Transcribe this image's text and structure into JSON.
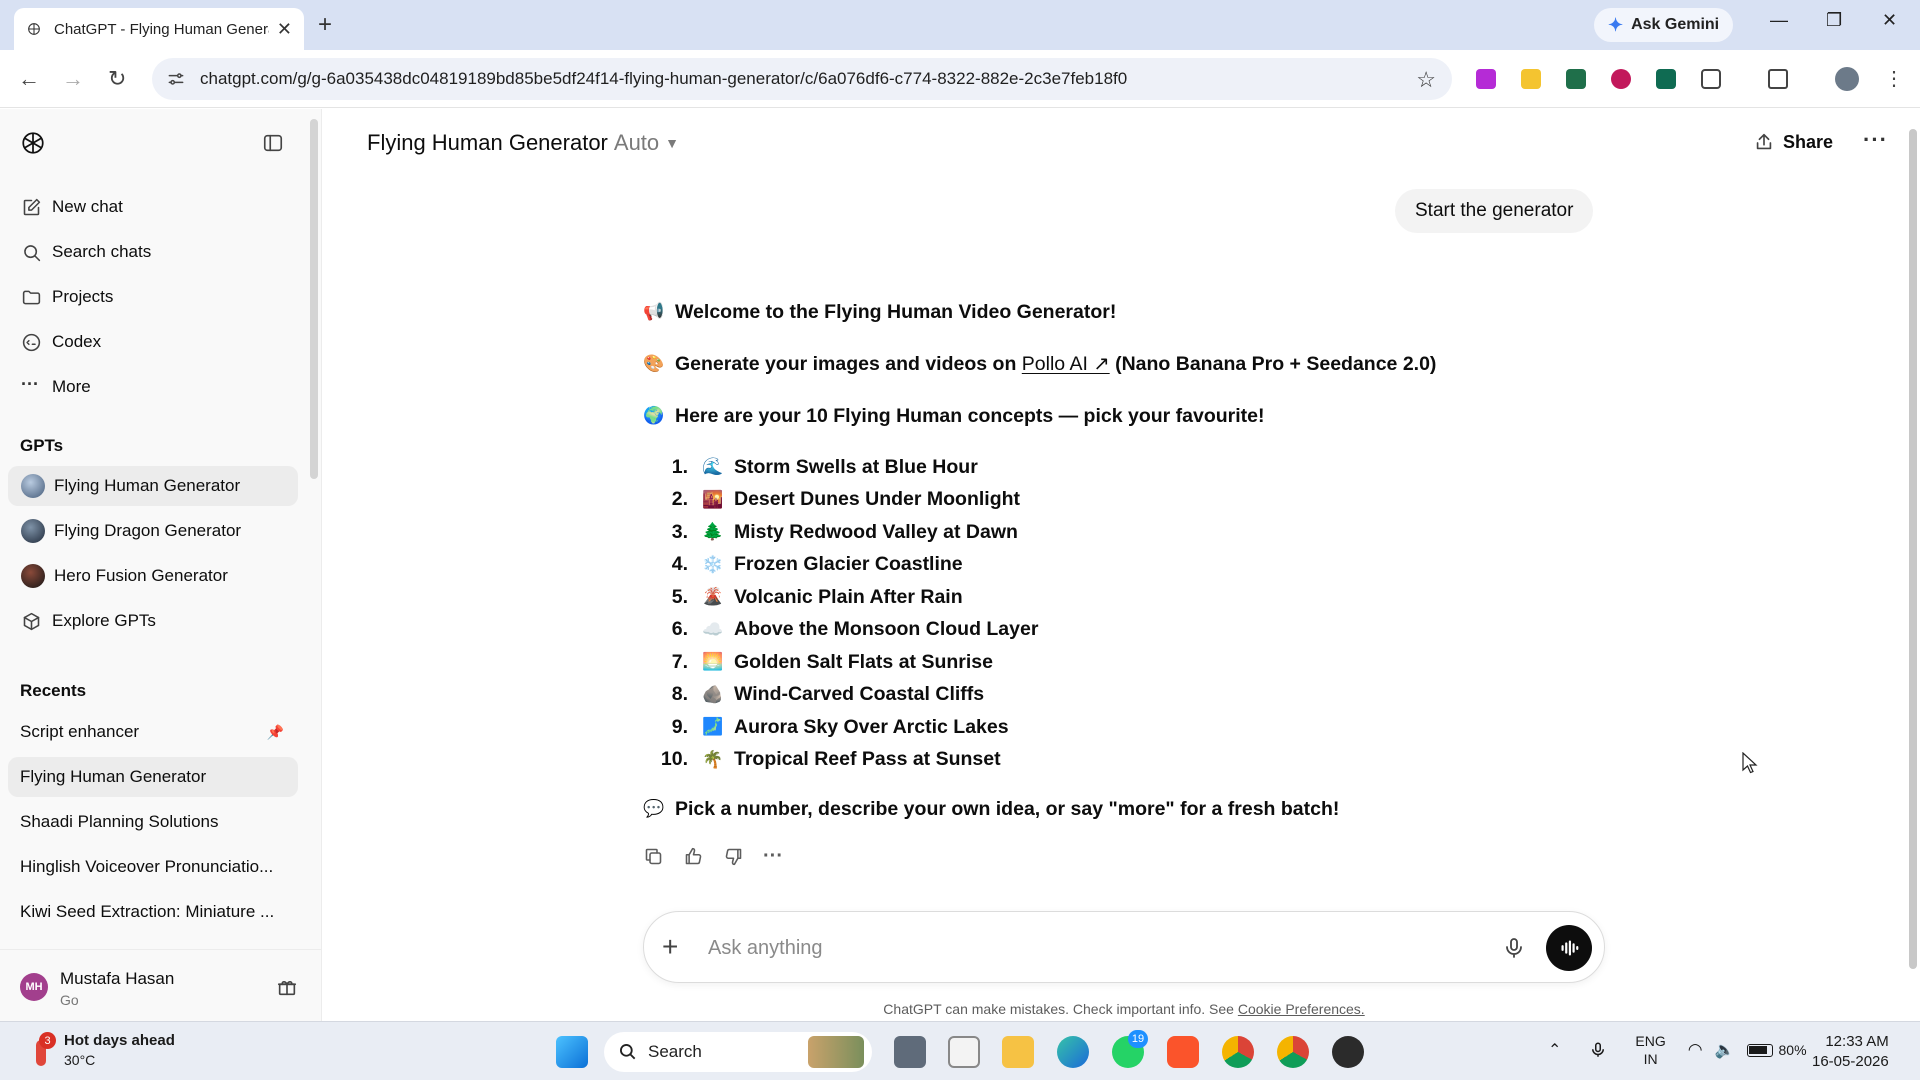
{
  "browser": {
    "tab_title": "ChatGPT - Flying Human Generator",
    "url": "chatgpt.com/g/g-6a035438dc04819189bd85be5df24f14-flying-human-generator/c/6a076df6-c774-8322-882e-2c3e7feb18f0",
    "ask_gemini": "Ask Gemini"
  },
  "sidebar": {
    "nav": [
      {
        "label": "New chat",
        "icon": "edit-icon"
      },
      {
        "label": "Search chats",
        "icon": "search-icon"
      },
      {
        "label": "Projects",
        "icon": "folder-icon"
      },
      {
        "label": "Codex",
        "icon": "codex-icon"
      },
      {
        "label": "More",
        "icon": "dots-icon"
      }
    ],
    "gpts_heading": "GPTs",
    "gpts": [
      {
        "label": "Flying Human Generator",
        "selected": true
      },
      {
        "label": "Flying Dragon Generator"
      },
      {
        "label": "Hero Fusion Generator"
      },
      {
        "label": "Explore GPTs",
        "icon": "cube-icon"
      }
    ],
    "recents_heading": "Recents",
    "recents": [
      {
        "label": "Script enhancer",
        "pinned": true
      },
      {
        "label": "Flying Human Generator",
        "selected": true
      },
      {
        "label": "Shaadi Planning Solutions"
      },
      {
        "label": "Hinglish Voiceover Pronunciatio..."
      },
      {
        "label": "Kiwi Seed Extraction: Miniature ..."
      }
    ],
    "user": {
      "initials": "MH",
      "name": "Mustafa Hasan",
      "plan": "Go"
    }
  },
  "header": {
    "model_name": "Flying Human Generator",
    "model_mode": "Auto",
    "share": "Share"
  },
  "conversation": {
    "user_message": "Start the generator",
    "welcome": "Welcome to the Flying Human Video Generator!",
    "generate_prefix": "Generate your images and videos on",
    "generate_link": "Pollo AI ↗",
    "generate_suffix": "(Nano Banana Pro + Seedance 2.0)",
    "concepts_intro": "Here are your 10 Flying Human concepts — pick your favourite!",
    "concepts": [
      {
        "num": "1.",
        "emoji": "🌊",
        "title": "Storm Swells at Blue Hour"
      },
      {
        "num": "2.",
        "emoji": "🌇",
        "title": "Desert Dunes Under Moonlight"
      },
      {
        "num": "3.",
        "emoji": "🌲",
        "title": "Misty Redwood Valley at Dawn"
      },
      {
        "num": "4.",
        "emoji": "❄️",
        "title": "Frozen Glacier Coastline"
      },
      {
        "num": "5.",
        "emoji": "🌋",
        "title": "Volcanic Plain After Rain"
      },
      {
        "num": "6.",
        "emoji": "☁️",
        "title": "Above the Monsoon Cloud Layer"
      },
      {
        "num": "7.",
        "emoji": "🌅",
        "title": "Golden Salt Flats at Sunrise"
      },
      {
        "num": "8.",
        "emoji": "🪨",
        "title": "Wind-Carved Coastal Cliffs"
      },
      {
        "num": "9.",
        "emoji": "🗾",
        "title": "Aurora Sky Over Arctic Lakes"
      },
      {
        "num": "10.",
        "emoji": "🌴",
        "title": "Tropical Reef Pass at Sunset"
      }
    ],
    "closing": "Pick a number, describe your own idea, or say \"more\" for a fresh batch!",
    "emoji": {
      "welcome": "📢",
      "generate": "🎨",
      "intro": "🌍",
      "closing": "💬"
    }
  },
  "composer": {
    "placeholder": "Ask anything",
    "disclaimer": "ChatGPT can make mistakes. Check important info. See",
    "disclaimer_link": "Cookie Preferences."
  },
  "taskbar": {
    "weather_badge": "3",
    "weather_title": "Hot days ahead",
    "weather_temp": "30°C",
    "search": "Search",
    "whatsapp_badge": "19",
    "lang_top": "ENG",
    "lang_bottom": "IN",
    "battery": "80%",
    "time": "12:33 AM",
    "date": "16-05-2026"
  },
  "colors": {
    "accent": "#0d0d0d",
    "sidebar_bg": "#f9f9f9",
    "tabbar_bg": "#d8e1f3"
  }
}
